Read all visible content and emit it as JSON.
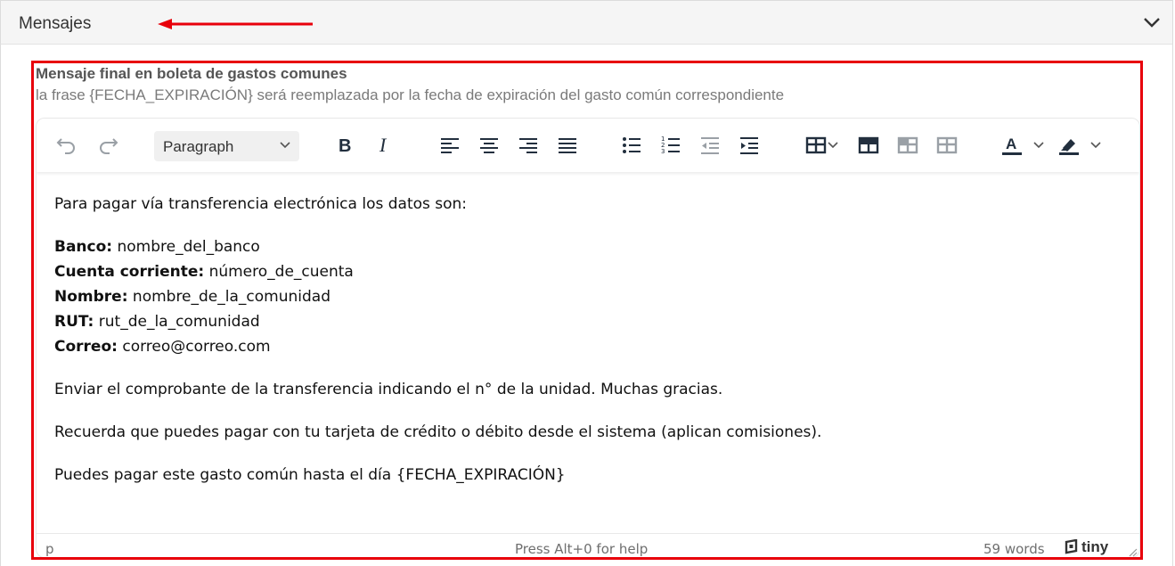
{
  "panel": {
    "title": "Mensajes"
  },
  "field": {
    "label": "Mensaje final en boleta de gastos comunes",
    "help": "la frase {FECHA_EXPIRACIÓN} será reemplazada por la fecha de expiración del gasto común correspondiente"
  },
  "toolbar": {
    "block_format": "Paragraph"
  },
  "content": {
    "intro": "Para pagar vía transferencia electrónica los datos son:",
    "details": [
      {
        "label": "Banco:",
        "value": " nombre_del_banco"
      },
      {
        "label": "Cuenta corriente:",
        "value": " número_de_cuenta"
      },
      {
        "label": "Nombre:",
        "value": " nombre_de_la_comunidad"
      },
      {
        "label": "RUT:",
        "value": " rut_de_la_comunidad"
      },
      {
        "label": "Correo:",
        "value": " correo@correo.com"
      }
    ],
    "p2": "Enviar el comprobante de la transferencia indicando el n° de la unidad. Muchas gracias.",
    "p3": "Recuerda que puedes pagar con tu tarjeta de crédito o débito desde el sistema (aplican comisiones).",
    "p4": "Puedes pagar este gasto común hasta el día {FECHA_EXPIRACIÓN}"
  },
  "statusbar": {
    "path": "p",
    "help": "Press Alt+0 for help",
    "words": "59 words",
    "logo": "tiny"
  },
  "colors": {
    "annotation_red": "#e8000b",
    "icon_gray": "#222f3e",
    "icon_disabled": "#9aa0a6"
  }
}
